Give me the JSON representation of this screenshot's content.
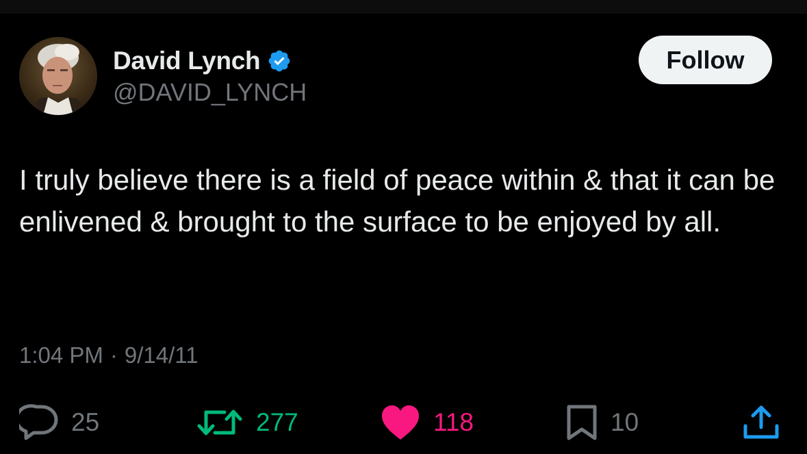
{
  "author": {
    "display_name": "David Lynch",
    "handle": "@DAVID_LYNCH",
    "verified": true,
    "avatar_icon": "profile-photo"
  },
  "follow_button": {
    "label": "Follow"
  },
  "tweet": {
    "text": "I truly believe there is a field of peace within & that it can be enlivened & brought to the surface to be enjoyed by all.",
    "time": "1:04 PM",
    "separator": "·",
    "date": "9/14/11"
  },
  "actions": {
    "reply": {
      "icon": "reply-icon",
      "count": "25"
    },
    "repost": {
      "icon": "repost-icon",
      "count": "277"
    },
    "like": {
      "icon": "heart-icon",
      "count": "118"
    },
    "bookmark": {
      "icon": "bookmark-icon",
      "count": "10"
    },
    "share": {
      "icon": "share-icon"
    }
  },
  "colors": {
    "background": "#000000",
    "text_primary": "#e7e9ea",
    "text_secondary": "#71767b",
    "verified_blue": "#1d9bf0",
    "repost_green": "#00ba7c",
    "like_pink": "#f91880",
    "follow_bg": "#eff3f4"
  }
}
